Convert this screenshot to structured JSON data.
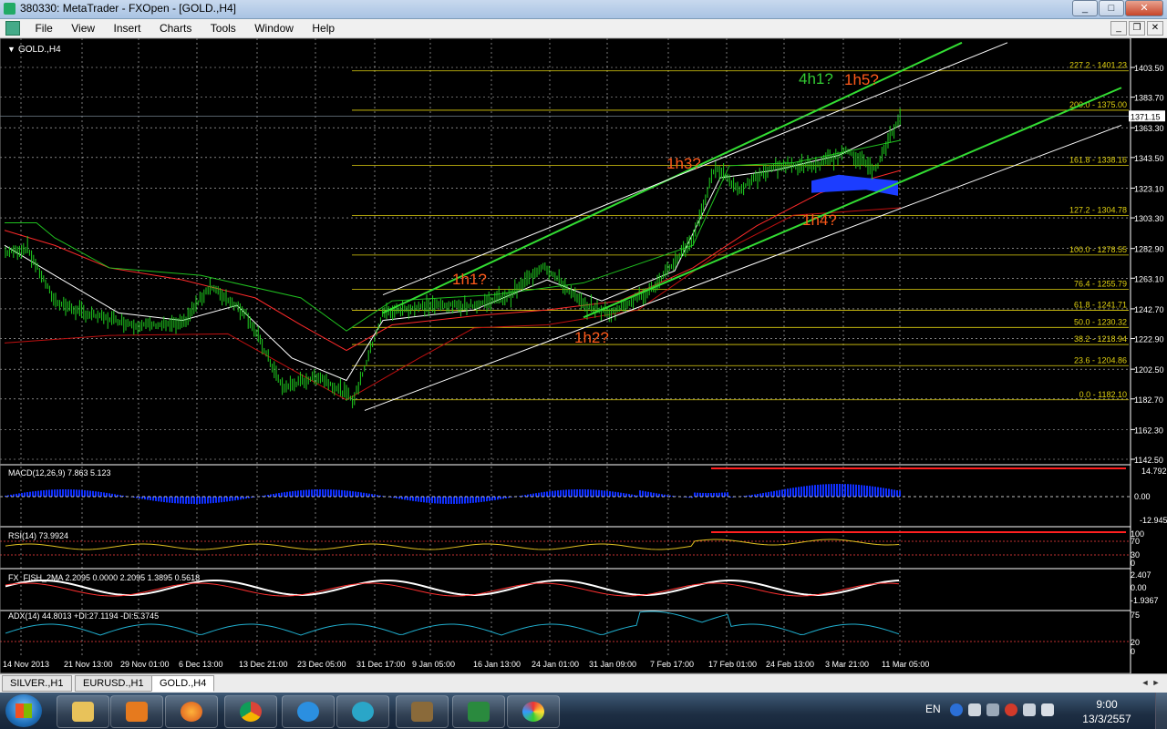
{
  "window": {
    "title": "380330: MetaTrader - FXOpen - [GOLD.,H4]",
    "minimize": "_",
    "maximize": "□",
    "close": "✕"
  },
  "menu": {
    "items": [
      "File",
      "View",
      "Insert",
      "Charts",
      "Tools",
      "Window",
      "Help"
    ],
    "mdi_buttons": [
      "_",
      "❐",
      "✕"
    ]
  },
  "chart": {
    "symbol_label": "GOLD.,H4",
    "price_axis": [
      "1403.50",
      "1383.70",
      "1363.30",
      "1343.50",
      "1323.10",
      "1303.30",
      "1282.90",
      "1263.10",
      "1242.70",
      "1222.90",
      "1202.50",
      "1182.70",
      "1162.30",
      "1142.50"
    ],
    "current_price": "1371.15",
    "time_axis": [
      "14 Nov 2013",
      "21 Nov 13:00",
      "29 Nov 01:00",
      "6 Dec 13:00",
      "13 Dec 21:00",
      "23 Dec 05:00",
      "31 Dec 17:00",
      "9 Jan 05:00",
      "16 Jan 13:00",
      "24 Jan 01:00",
      "31 Jan 09:00",
      "7 Feb 17:00",
      "17 Feb 01:00",
      "24 Feb 13:00",
      "3 Mar 21:00",
      "11 Mar 05:00"
    ],
    "fib_levels": [
      {
        "label": "227.2 - 1401.23",
        "price": 1401.23
      },
      {
        "label": "200.0 - 1375.00",
        "price": 1375.0
      },
      {
        "label": "161.8 - 1338.16",
        "price": 1338.16
      },
      {
        "label": "127.2 - 1304.78",
        "price": 1304.78
      },
      {
        "label": "100.0 - 1278.55",
        "price": 1278.55
      },
      {
        "label": "76.4 - 1255.79",
        "price": 1255.79
      },
      {
        "label": "61.8 - 1241.71",
        "price": 1241.71
      },
      {
        "label": "50.0 - 1230.32",
        "price": 1230.32
      },
      {
        "label": "38.2 - 1218.94",
        "price": 1218.94
      },
      {
        "label": "23.6 - 1204.86",
        "price": 1204.86
      },
      {
        "label": "0.0 - 1182.10",
        "price": 1182.1
      }
    ],
    "annotations": [
      {
        "text": "4h1?",
        "color": "#33cc33"
      },
      {
        "text": "1h5?",
        "color": "#ff5a1a"
      },
      {
        "text": "1h3?",
        "color": "#ff5a1a"
      },
      {
        "text": "1h4?",
        "color": "#ff5a1a"
      },
      {
        "text": "1h1?",
        "color": "#ff5a1a"
      },
      {
        "text": "1h2?",
        "color": "#ff5a1a"
      }
    ],
    "colors": {
      "grid": "#ffffff",
      "fib": "#e0d010",
      "channel_green": "#33dd33",
      "channel_white": "#ffffff",
      "ma_red": "#d01010",
      "ma_green": "#20c020",
      "annotation_orange": "#ff5a1a",
      "annotation_green": "#33cc33",
      "histogram_blue": "#1030ff"
    }
  },
  "indicators": {
    "macd": {
      "label": "MACD(12,26,9) 7.863 5.123",
      "axis": [
        "14.792",
        "0.00",
        "-12.945"
      ]
    },
    "rsi": {
      "label": "RSI(14) 73.9924",
      "axis": [
        "100",
        "70",
        "30",
        "0"
      ]
    },
    "fisher": {
      "label": "FX_FISH_2MA 2.2095 0.0000 2.2095 1.3895 0.5618",
      "axis": [
        "2.407",
        "0.00",
        "-1.9367"
      ]
    },
    "adx": {
      "label": "ADX(14) 44.8013 +DI:27.1194 -DI:5.3745",
      "axis": [
        "75",
        "20",
        "0"
      ]
    }
  },
  "tabs": {
    "items": [
      "SILVER.,H1",
      "EURUSD.,H1",
      "GOLD.,H4"
    ],
    "active": 2
  },
  "taskbar": {
    "language": "EN",
    "time": "9:00",
    "date": "13/3/2557",
    "apps": [
      "folder-icon",
      "media-player-icon",
      "firefox-icon",
      "chrome-icon",
      "ie-icon",
      "metatrader-icon",
      "gimp-icon",
      "excel-icon",
      "paint-icon"
    ]
  }
}
